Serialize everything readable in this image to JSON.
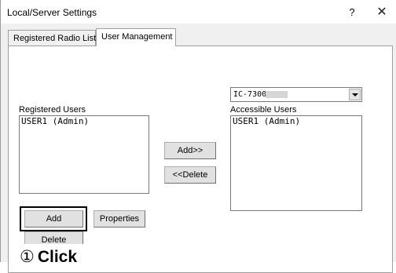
{
  "window": {
    "title": "Local/Server Settings",
    "help_label": "?",
    "close_label": "✕"
  },
  "tabs": [
    {
      "label": "Registered Radio List",
      "active": false
    },
    {
      "label": "User Management",
      "active": true
    }
  ],
  "user_management": {
    "radio_select": {
      "value": "IC-7300",
      "masked_suffix": true
    },
    "registered_users": {
      "label": "Registered Users",
      "items": [
        "USER1 (Admin)"
      ]
    },
    "accessible_users": {
      "label": "Accessible Users",
      "items": [
        "USER1 (Admin)"
      ]
    },
    "buttons": {
      "add_accessible": "Add>>",
      "delete_accessible": "<<Delete",
      "add_user": "Add",
      "properties": "Properties",
      "delete_user": "Delete"
    }
  },
  "annotation": {
    "step_number": "①",
    "step_text": "Click"
  },
  "icons": [
    "help-icon",
    "close-icon",
    "dropdown-arrow-icon"
  ]
}
